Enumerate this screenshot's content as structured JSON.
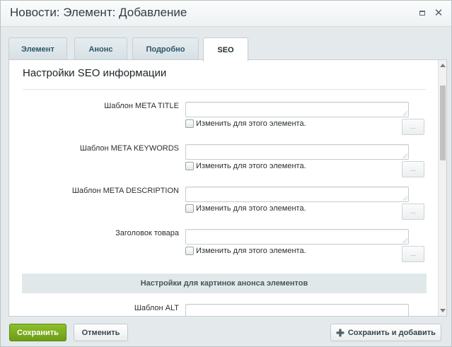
{
  "window": {
    "title": "Новости: Элемент: Добавление"
  },
  "tabs": [
    {
      "label": "Элемент"
    },
    {
      "label": "Анонс"
    },
    {
      "label": "Подробно"
    },
    {
      "label": "SEO"
    }
  ],
  "active_tab": "SEO",
  "section": {
    "title": "Настройки SEO информации"
  },
  "fields": [
    {
      "label": "Шаблон META TITLE",
      "value": "",
      "checkbox_label": "Изменить для этого элемента.",
      "checked": false,
      "button_label": "..."
    },
    {
      "label": "Шаблон META KEYWORDS",
      "value": "",
      "checkbox_label": "Изменить для этого элемента.",
      "checked": false,
      "button_label": "..."
    },
    {
      "label": "Шаблон META DESCRIPTION",
      "value": "",
      "checkbox_label": "Изменить для этого элемента.",
      "checked": false,
      "button_label": "..."
    },
    {
      "label": "Заголовок товара",
      "value": "",
      "checkbox_label": "Изменить для этого элемента.",
      "checked": false,
      "button_label": "..."
    }
  ],
  "subsection": {
    "title": "Настройки для картинок анонса элементов"
  },
  "alt_field": {
    "label": "Шаблон ALT",
    "value": ""
  },
  "footer": {
    "save_label": "Сохранить",
    "cancel_label": "Отменить",
    "save_add_label": "Сохранить и добавить"
  },
  "colors": {
    "save_button": "#7aa81f",
    "tab_text": "#2f5668",
    "subheader_bg": "#e0e8ea"
  }
}
